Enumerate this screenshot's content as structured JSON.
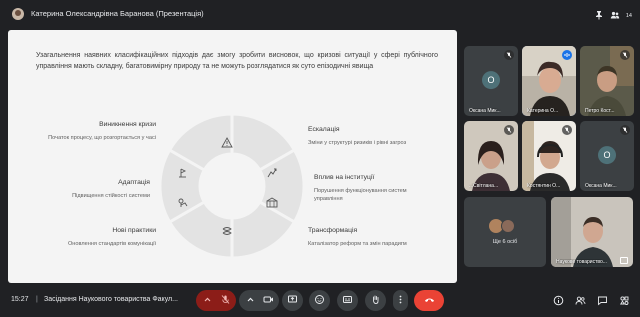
{
  "window": {
    "title": "Катерина Олександрівна Баранова (Презентація)",
    "participants_count": "14"
  },
  "slide": {
    "intro": "Узагальнення наявних класифікаційних підходів дає змогу зробити висновок, що кризові ситуації у сфері публічного управління мають складну, багатовимірну природу та не можуть розглядатися як суто епізодичні явища",
    "stages": [
      {
        "title": "Виникнення кризи",
        "desc": "Початок процесу, що розгортається у часі",
        "icon": "warning-icon"
      },
      {
        "title": "Ескалація",
        "desc": "Зміни у структурі ризиків і рівні загроз",
        "icon": "escalation-icon"
      },
      {
        "title": "Вплив на інституції",
        "desc": "Порушення функціонування систем управління",
        "icon": "institutions-icon"
      },
      {
        "title": "Трансформація",
        "desc": "Каталізатор реформ та змін парадигм",
        "icon": "transformation-icon"
      },
      {
        "title": "Нові практики",
        "desc": "Оновлення стандартів комунікації",
        "icon": "practices-icon"
      },
      {
        "title": "Адаптація",
        "desc": "Підвищення стійкості системи",
        "icon": "adaptation-icon"
      }
    ]
  },
  "participants": [
    {
      "name": "Оксана Мик...",
      "avatar_letter": "O",
      "avatar_color": "#4e7178",
      "muted": true
    },
    {
      "name": "Катерина О...",
      "muted": false,
      "speaking": true
    },
    {
      "name": "Петро Кост...",
      "muted": true
    },
    {
      "name": "...Світлана...",
      "muted": true
    },
    {
      "name": "Костянтин О...",
      "muted": true
    },
    {
      "name": "Оксана Мик...",
      "avatar_letter": "O",
      "avatar_color": "#4e7178",
      "muted": true
    },
    {
      "name": "Ще 6 осіб",
      "muted": false
    },
    {
      "name": "Наукове товариство...",
      "muted": false
    }
  ],
  "meeting": {
    "time": "15:27",
    "separator": "|",
    "name": "Засідання Наукового товариства Факул..."
  },
  "colors": {
    "background": "#202124",
    "slide_bg": "#f4f4f4",
    "end_call": "#ea4335",
    "mic_off": "#8c1d18",
    "active_speaker": "#8ab4f8"
  }
}
